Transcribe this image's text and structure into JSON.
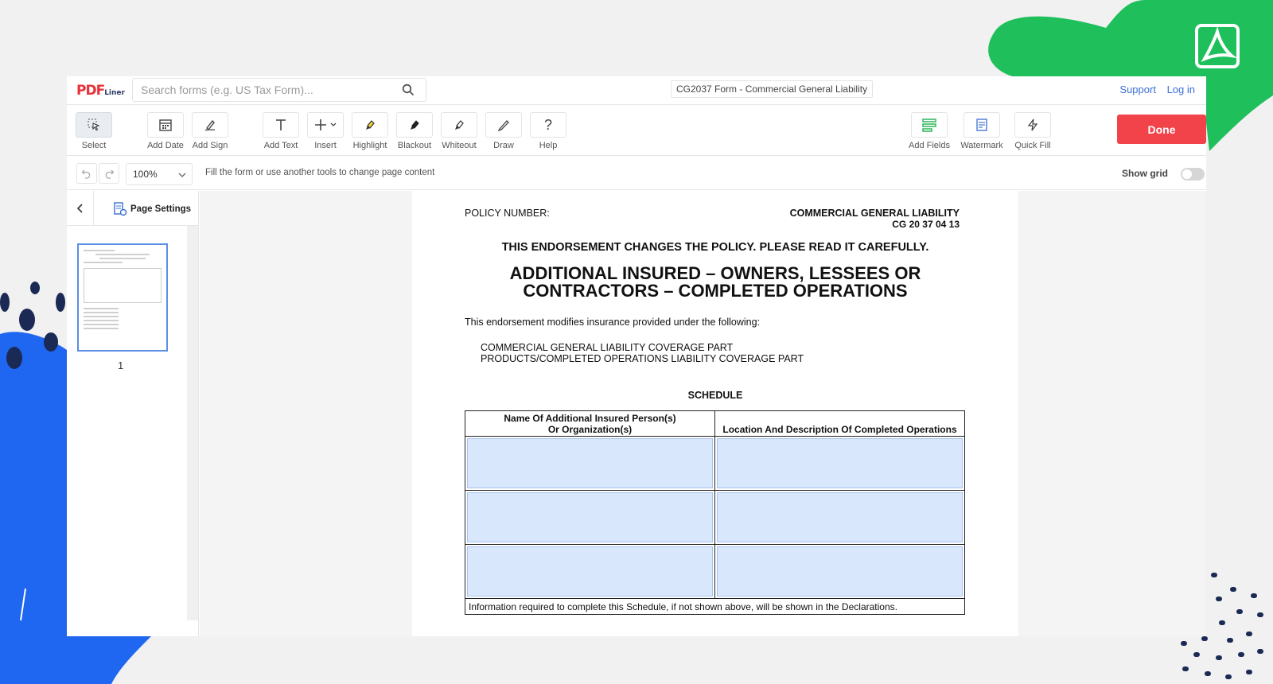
{
  "header": {
    "logo_main": "PDF",
    "logo_sub": "Liner",
    "search_placeholder": "Search forms (e.g. US Tax Form)...",
    "document_title": "CG2037 Form - Commercial General Liability",
    "support_link": "Support",
    "login_link": "Log in"
  },
  "toolbar": {
    "select": "Select",
    "add_date": "Add Date",
    "add_sign": "Add Sign",
    "add_text": "Add Text",
    "insert": "Insert",
    "highlight": "Highlight",
    "blackout": "Blackout",
    "whiteout": "Whiteout",
    "draw": "Draw",
    "help": "Help",
    "add_fields": "Add Fields",
    "watermark": "Watermark",
    "quick_fill": "Quick Fill",
    "done": "Done"
  },
  "subbar": {
    "zoom": "100%",
    "hint": "Fill the form or use another tools to change page content",
    "show_grid": "Show grid"
  },
  "sidebar": {
    "page_settings": "Page Settings",
    "page_number": "1"
  },
  "document": {
    "policy_number": "POLICY NUMBER:",
    "form_line1": "COMMERCIAL GENERAL LIABILITY",
    "form_line2": "CG 20 37 04 13",
    "notice": "THIS ENDORSEMENT CHANGES THE POLICY.  PLEASE READ IT CAREFULLY.",
    "title1": "ADDITIONAL INSURED – OWNERS, LESSEES OR",
    "title2": "CONTRACTORS – COMPLETED OPERATIONS",
    "intro": "This endorsement modifies insurance provided under the following:",
    "part1": "COMMERCIAL GENERAL LIABILITY COVERAGE PART",
    "part2": "PRODUCTS/COMPLETED OPERATIONS LIABILITY COVERAGE PART",
    "schedule": "SCHEDULE",
    "col1_line1": "Name Of Additional Insured Person(s)",
    "col1_line2": "Or Organization(s)",
    "col2": "Location And Description Of Completed Operations",
    "footer": "Information required to complete this Schedule, if not shown above, will be shown in the Declarations."
  }
}
